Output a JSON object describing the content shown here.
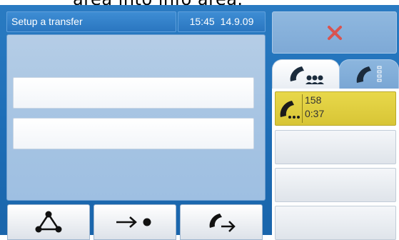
{
  "caption_text": "area into info area.",
  "header": {
    "title": "Setup a transfer",
    "time": "15:45",
    "date": "14.9.09"
  },
  "fields": [
    {
      "value": ""
    },
    {
      "value": ""
    }
  ],
  "buttons": [
    {
      "icon": "conference-triangle-icon"
    },
    {
      "icon": "arrow-to-dot-icon"
    },
    {
      "icon": "handset-transfer-arrow-icon"
    }
  ],
  "close_button": {
    "icon": "close-x-icon",
    "color": "#d9534f"
  },
  "tabs": [
    {
      "icon": "conference-handset-icon",
      "active": true
    },
    {
      "icon": "handset-hold-icon",
      "active": false
    }
  ],
  "calls": [
    {
      "number": "158",
      "duration": "0:37",
      "icon": "handset-calling-icon",
      "active": true
    },
    {
      "number": "",
      "duration": "",
      "active": false
    },
    {
      "number": "",
      "duration": "",
      "active": false
    },
    {
      "number": "",
      "duration": "",
      "active": false
    }
  ],
  "colors": {
    "accent": "#1d6db6",
    "active_call": "#e0cf40",
    "close": "#d9534f"
  }
}
